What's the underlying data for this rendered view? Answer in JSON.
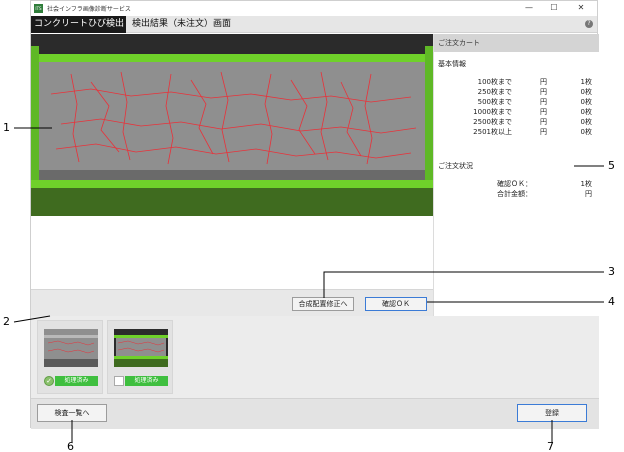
{
  "window": {
    "app_title": "社会インフラ画像診断サービス",
    "app_icon_text": "ITS",
    "min_glyph": "—",
    "max_glyph": "☐",
    "close_glyph": "✕"
  },
  "header": {
    "active_tab": "コンクリートひび検出",
    "screen_title": "検出結果（未注文）画面",
    "help_glyph": "?"
  },
  "cart": {
    "title": "ご注文カート",
    "basic_info_label": "基本情報",
    "price_rows": [
      {
        "tier": "100枚まで",
        "unit": "円",
        "qty": "1枚"
      },
      {
        "tier": "250枚まで",
        "unit": "円",
        "qty": "0枚"
      },
      {
        "tier": "500枚まで",
        "unit": "円",
        "qty": "0枚"
      },
      {
        "tier": "1000枚まで",
        "unit": "円",
        "qty": "0枚"
      },
      {
        "tier": "2500枚まで",
        "unit": "円",
        "qty": "0枚"
      },
      {
        "tier": "2501枚以上",
        "unit": "円",
        "qty": "0枚"
      }
    ],
    "order_status_label": "ご注文状況",
    "status_rows": [
      {
        "label": "確認ＯＫ：",
        "value": "1枚"
      },
      {
        "label": "合計金額：",
        "value": "円"
      }
    ]
  },
  "actions": {
    "reposition_label": "合成配置修正へ",
    "confirm_label": "確認ＯＫ"
  },
  "thumbnails": [
    {
      "status": "処理済み",
      "checked": true,
      "check_glyph": "✓"
    },
    {
      "status": "処理済み",
      "checked": false
    }
  ],
  "footer": {
    "list_label": "検査一覧へ",
    "register_label": "登録"
  },
  "callouts": [
    "1",
    "2",
    "3",
    "4",
    "5",
    "6",
    "7"
  ],
  "colors": {
    "accent_green": "#3fbf3f",
    "beam_green": "#6fd12a",
    "crack_red": "#e8323a",
    "confirm_border": "#3b7bd6"
  }
}
